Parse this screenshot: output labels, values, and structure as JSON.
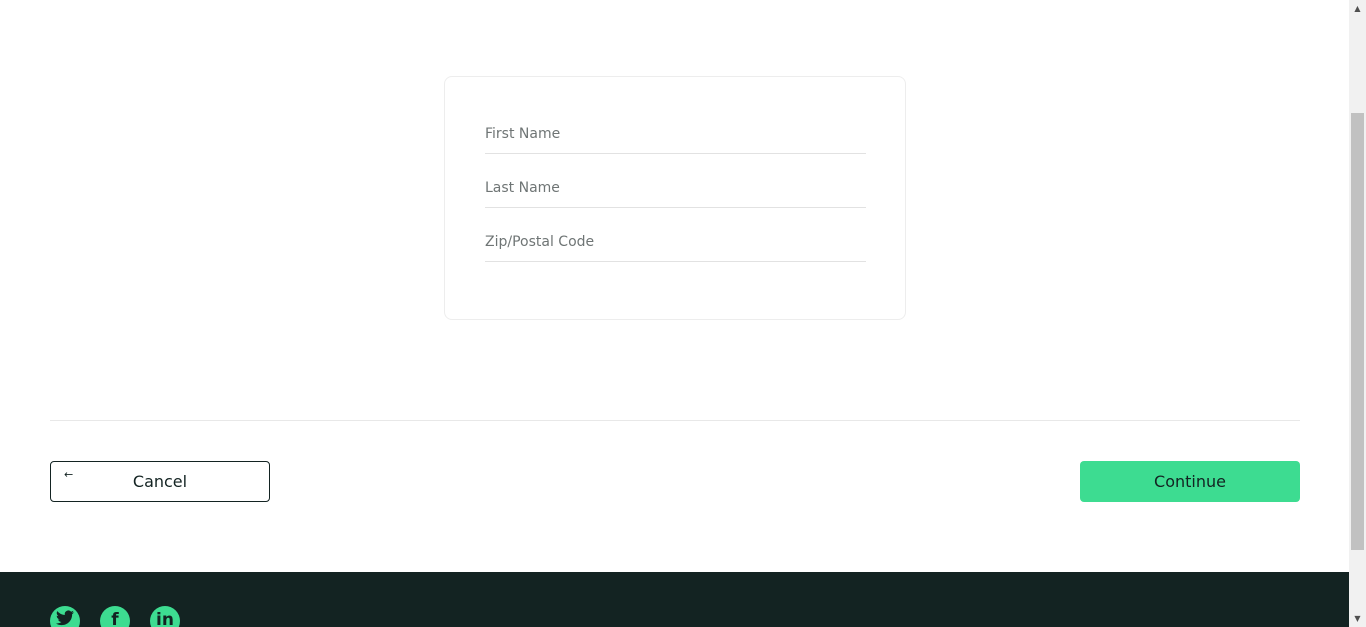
{
  "form": {
    "first_name_placeholder": "First Name",
    "last_name_placeholder": "Last Name",
    "zip_placeholder": "Zip/Postal Code"
  },
  "actions": {
    "cancel_label": "Cancel",
    "cancel_icon": "arrow-left-icon",
    "continue_label": "Continue"
  },
  "footer": {
    "social": [
      {
        "icon": "twitter-icon",
        "glyph": "🐦"
      },
      {
        "icon": "facebook-icon",
        "glyph": "f"
      },
      {
        "icon": "linkedin-icon",
        "glyph": "in"
      }
    ]
  },
  "colors": {
    "accent": "#3ddc91",
    "dark": "#132322"
  }
}
